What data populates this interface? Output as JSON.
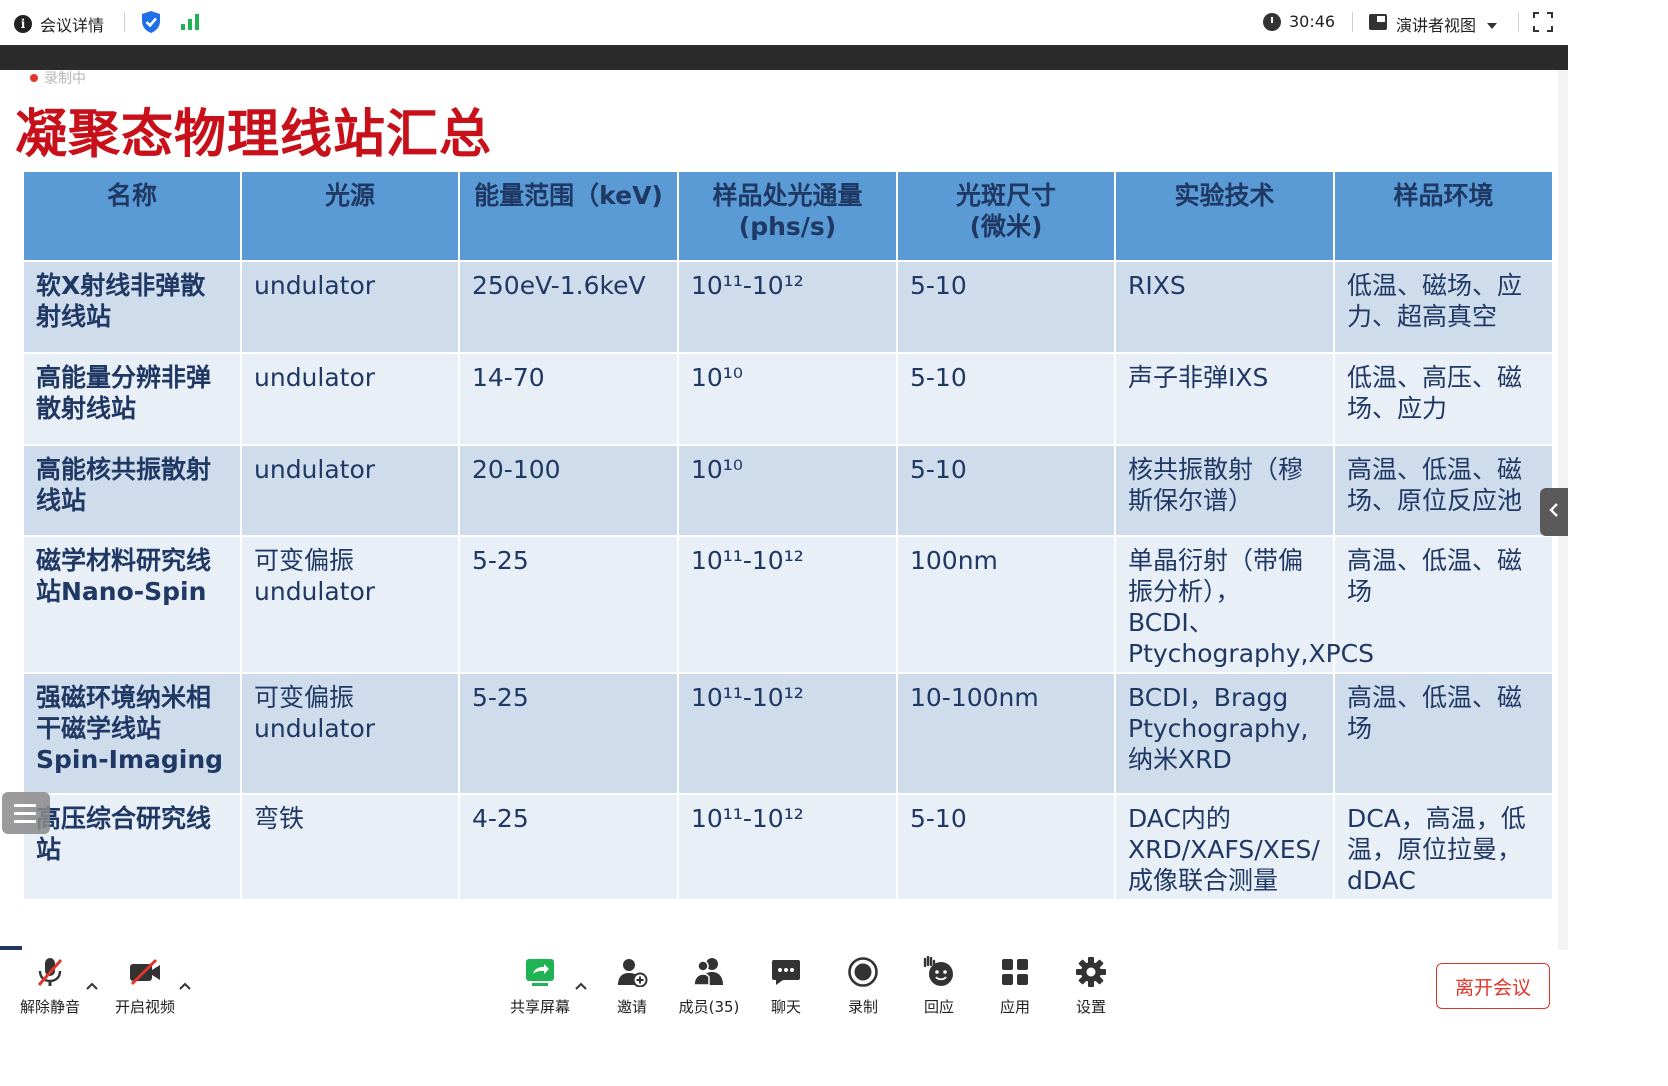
{
  "topbar": {
    "meeting_info": "会议详情",
    "timer": "30:46",
    "view_mode": "演讲者视图"
  },
  "slide": {
    "recording": "录制中",
    "title": "凝聚态物理线站汇总",
    "columns": [
      "名称",
      "光源",
      "能量范围（keV)",
      "样品处光通量\n(phs/s)",
      "光斑尺寸\n(微米)",
      "实验技术",
      "样品环境"
    ],
    "rows": [
      {
        "name": "软X射线非弹散射线站",
        "source": "undulator",
        "energy": "250eV-1.6keV",
        "flux": "10¹¹-10¹²",
        "spot": "5-10",
        "technique": "RIXS",
        "environment": "低温、磁场、应力、超高真空"
      },
      {
        "name": "高能量分辨非弹散射线站",
        "source": "undulator",
        "energy": "14-70",
        "flux": "10¹⁰",
        "spot": "5-10",
        "technique": "声子非弹IXS",
        "environment": "低温、高压、磁场、应力"
      },
      {
        "name": "高能核共振散射线站",
        "source": "undulator",
        "energy": "20-100",
        "flux": "10¹⁰",
        "spot": "5-10",
        "technique": "核共振散射（穆斯保尔谱）",
        "environment": "高温、低温、磁场、原位反应池"
      },
      {
        "name": "磁学材料研究线站Nano-Spin",
        "source": "可变偏振undulator",
        "energy": "5-25",
        "flux": "10¹¹-10¹²",
        "spot": "100nm",
        "technique": "单晶衍射（带偏振分析），BCDI、Ptychography,XPCS",
        "environment": "高温、低温、磁场"
      },
      {
        "name": "强磁环境纳米相干磁学线站Spin-Imaging",
        "source": "可变偏振undulator",
        "energy": "5-25",
        "flux": "10¹¹-10¹²",
        "spot": "10-100nm",
        "technique": "BCDI，Bragg Ptychography,纳米XRD",
        "environment": "高温、低温、磁场"
      },
      {
        "name": "高压综合研究线站",
        "source": "弯铁",
        "energy": "4-25",
        "flux": "10¹¹-10¹²",
        "spot": "5-10",
        "technique": "DAC内的XRD/XAFS/XES/成像联合测量",
        "environment": "DCA，高温，低温，原位拉曼，dDAC"
      }
    ]
  },
  "toolbar": {
    "unmute": "解除静音",
    "start_video": "开启视频",
    "share_screen": "共享屏幕",
    "invite": "邀请",
    "members": "成员(35)",
    "chat": "聊天",
    "record": "录制",
    "reactions": "回应",
    "apps": "应用",
    "settings": "设置",
    "leave": "离开会议"
  },
  "colors": {
    "title_red": "#c8101a",
    "header_blue": "#5b9bd5",
    "row_dark": "#cfdcec",
    "row_light": "#e9eff7",
    "text_navy": "#1f3864",
    "share_green": "#20b354",
    "shield_blue": "#1e6fe8"
  }
}
